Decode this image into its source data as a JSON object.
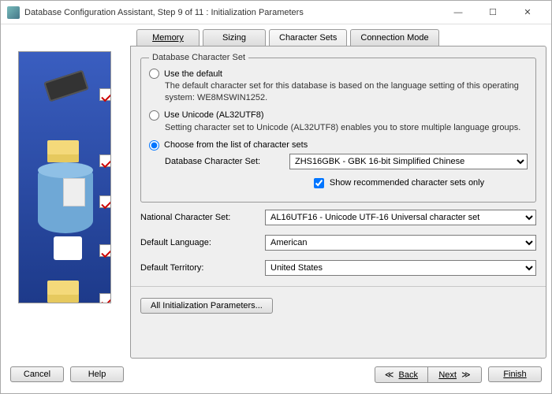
{
  "window": {
    "title": "Database Configuration Assistant, Step 9 of 11 : Initialization Parameters"
  },
  "tabs": {
    "memory": "Memory",
    "sizing": "Sizing",
    "charsets": "Character Sets",
    "connmode": "Connection Mode"
  },
  "charset_group": {
    "legend": "Database Character Set",
    "use_default_label": "Use the default",
    "use_default_desc": "The default character set for this database is based on the language setting of this operating system: WE8MSWIN1252.",
    "use_unicode_label": "Use Unicode (AL32UTF8)",
    "use_unicode_desc": "Setting character set to Unicode (AL32UTF8) enables you to store multiple language groups.",
    "choose_label": "Choose from the list of character sets",
    "db_charset_label": "Database Character Set:",
    "db_charset_value": "ZHS16GBK - GBK 16-bit Simplified Chinese",
    "show_recommended": "Show recommended character sets only"
  },
  "params": {
    "national_label": "National Character Set:",
    "national_value": "AL16UTF16 - Unicode UTF-16 Universal character set",
    "lang_label": "Default Language:",
    "lang_value": "American",
    "territory_label": "Default Territory:",
    "territory_value": "United States"
  },
  "buttons": {
    "all_params": "All Initialization Parameters...",
    "cancel": "Cancel",
    "help": "Help",
    "back": "Back",
    "next": "Next",
    "finish": "Finish"
  }
}
